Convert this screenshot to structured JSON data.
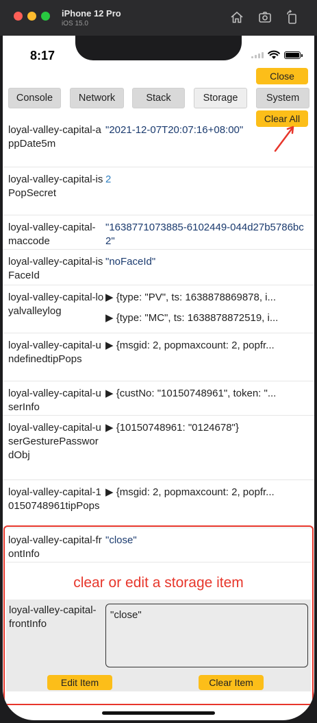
{
  "device": {
    "name": "iPhone 12 Pro",
    "os": "iOS 15.0",
    "title_icons": [
      "home-icon",
      "screenshot-icon",
      "rotate-icon"
    ]
  },
  "status_bar": {
    "time": "8:17"
  },
  "toolbar": {
    "close_label": "Close",
    "clear_all_label": "Clear All",
    "tabs": [
      {
        "label": "Console"
      },
      {
        "label": "Network"
      },
      {
        "label": "Stack"
      },
      {
        "label": "Storage"
      },
      {
        "label": "System"
      }
    ],
    "active_tab": "Storage"
  },
  "storage": {
    "items": [
      {
        "key": "loyal-valley-capital-appDate5m",
        "value": "\"2021-12-07T20:07:16+08:00\""
      },
      {
        "key": "loyal-valley-capital-isPopSecret",
        "value": "2"
      },
      {
        "key": "loyal-valley-capital-maccode",
        "value": "\"1638771073885-6102449-044d27b5786bc2\""
      },
      {
        "key": "loyal-valley-capital-isFaceId",
        "value": "\"noFaceId\""
      },
      {
        "key": "loyal-valley-capital-loyalvalleylog",
        "lines": [
          "▶ {type: \"PV\", ts: 1638878869878, i...",
          "▶ {type: \"MC\", ts: 1638878872519, i..."
        ]
      },
      {
        "key": "loyal-valley-capital-undefinedtipPops",
        "lines": [
          "▶ {msgid: 2, popmaxcount: 2, popfr..."
        ]
      },
      {
        "key": "loyal-valley-capital-userInfo",
        "lines": [
          "▶ {custNo: \"10150748961\", token: \"..."
        ]
      },
      {
        "key": "loyal-valley-capital-userGesturePasswordObj",
        "lines": [
          "▶ {10150748961: \"0124678\"}"
        ]
      },
      {
        "key": "loyal-valley-capital-10150748961tipPops",
        "lines": [
          "▶ {msgid: 2, popmaxcount: 2, popfr..."
        ]
      },
      {
        "key": "loyal-valley-capital-frontInfo",
        "value": "\"close\""
      }
    ]
  },
  "annotation": {
    "text": "clear or edit a storage item",
    "color": "#e7362b"
  },
  "editor": {
    "key": "loyal-valley-capital-frontInfo",
    "value": "\"close\"",
    "edit_label": "Edit Item",
    "clear_label": "Clear Item"
  },
  "colors": {
    "accent": "#fcbe19",
    "annotation": "#e7362b"
  }
}
